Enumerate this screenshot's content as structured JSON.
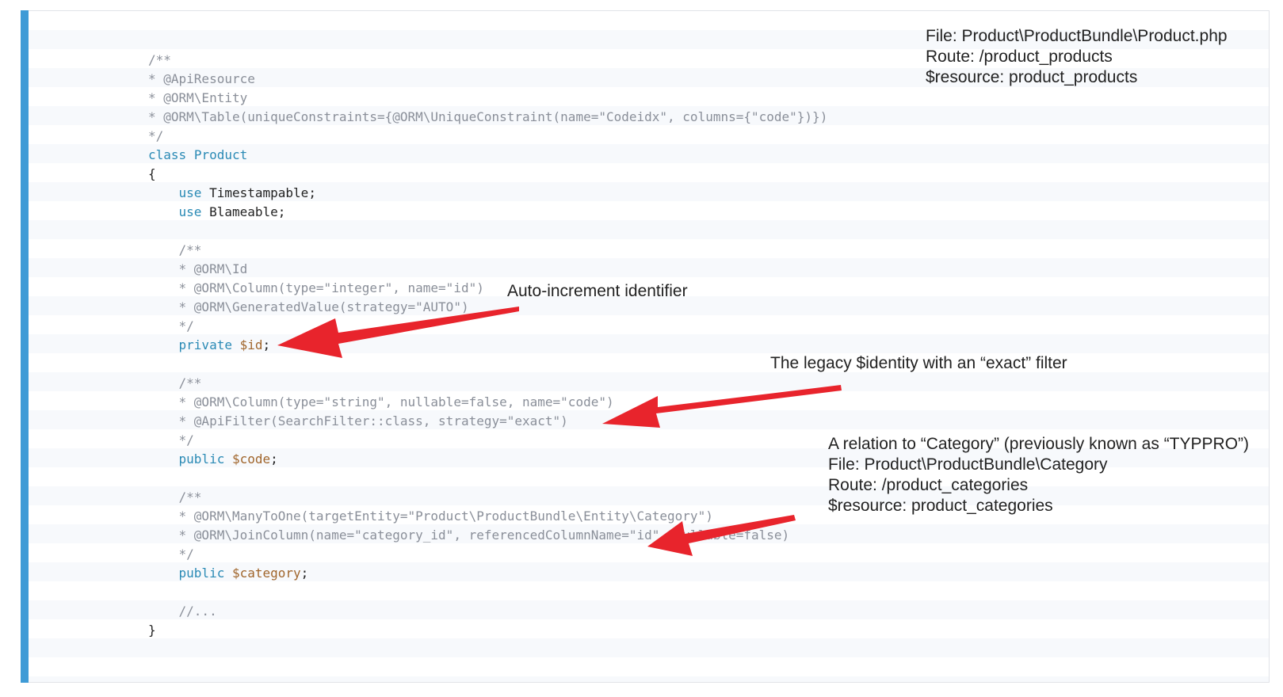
{
  "file_note": {
    "lines": [
      "File: Product\\ProductBundle\\Product.php",
      "Route: /product_products",
      "$resource: product_products"
    ]
  },
  "code": {
    "doc_open": "/**",
    "ann_api_resource": "* @ApiResource",
    "ann_orm_entity": "* @ORM\\Entity",
    "ann_orm_table": "* @ORM\\Table(uniqueConstraints={@ORM\\UniqueConstraint(name=\"Codeidx\", columns={\"code\"})})",
    "doc_close": "*/",
    "class_kw": "class",
    "class_name": "Product",
    "brace_open": "{",
    "use_kw": "use",
    "trait_timestampable": "Timestampable",
    "trait_blameable": "Blameable",
    "semicolon": ";",
    "id_doc_open": "/**",
    "id_ann_id": "* @ORM\\Id",
    "id_ann_column": "* @ORM\\Column(type=\"integer\", name=\"id\")",
    "id_ann_generated": "* @ORM\\GeneratedValue(strategy=\"AUTO\")",
    "id_doc_close": "*/",
    "private_kw": "private",
    "id_var": "$id",
    "code_doc_open": "/**",
    "code_ann_column": "* @ORM\\Column(type=\"string\", nullable=false, name=\"code\")",
    "code_ann_filter": "* @ApiFilter(SearchFilter::class, strategy=\"exact\")",
    "code_doc_close": "*/",
    "public_kw": "public",
    "code_var": "$code",
    "cat_doc_open": "/**",
    "cat_ann_many": "* @ORM\\ManyToOne(targetEntity=\"Product\\ProductBundle\\Entity\\Category\")",
    "cat_ann_join": "* @ORM\\JoinColumn(name=\"category_id\", referencedColumnName=\"id\", nullable=false)",
    "cat_doc_close": "*/",
    "category_var": "$category",
    "ellipsis_comment": "//...",
    "brace_close": "}"
  },
  "annotations": {
    "id_note": "Auto-increment identifier",
    "code_note": "The legacy $identity with an “exact” filter",
    "category_note": {
      "lines": [
        "A relation to “Category” (previously known as “TYPPRO”)",
        "File: Product\\ProductBundle\\Category",
        "Route: /product_categories",
        "$resource: product_categories"
      ]
    }
  },
  "colors": {
    "left_bar": "#3f9bd6",
    "arrow": "#e8242c",
    "keyword": "#2a8ab5",
    "variable": "#a0652b",
    "comment": "#8a8f99"
  }
}
